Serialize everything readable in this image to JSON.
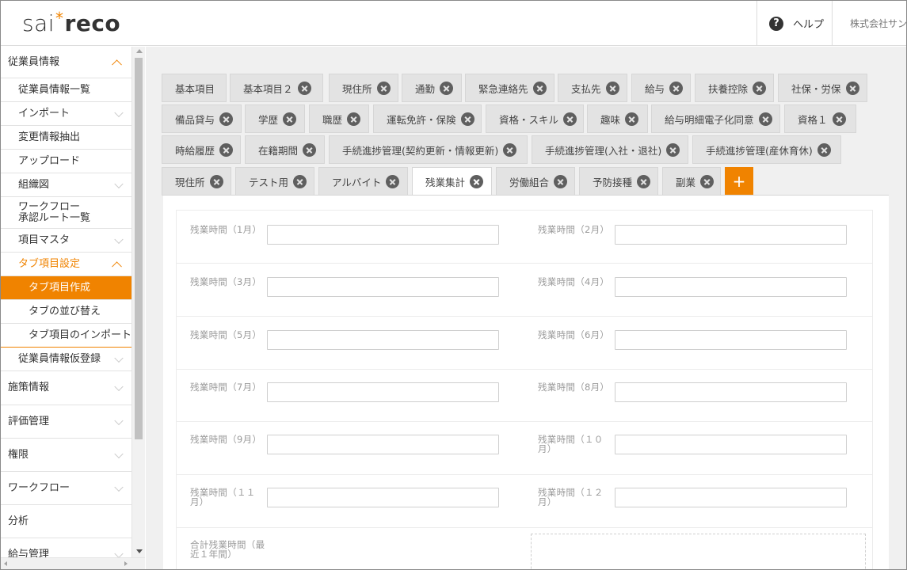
{
  "header": {
    "logo_part1": "sai",
    "logo_star": "*",
    "logo_part2": "reco",
    "help_icon": "?",
    "help_label": "ヘルプ",
    "company": "株式会社サン"
  },
  "sidebar": {
    "items": [
      {
        "label": "従業員情報"
      },
      {
        "label": "従業員情報一覧"
      },
      {
        "label": "インポート"
      },
      {
        "label": "変更情報抽出"
      },
      {
        "label": "アップロード"
      },
      {
        "label": "組織図"
      },
      {
        "label": "ワークフロー\n承認ルート一覧"
      },
      {
        "label": "項目マスタ"
      },
      {
        "label": "タブ項目設定"
      },
      {
        "label": "タブ項目作成"
      },
      {
        "label": "タブの並び替え"
      },
      {
        "label": "タブ項目のインポート"
      },
      {
        "label": "従業員情報仮登録"
      },
      {
        "label": "施策情報"
      },
      {
        "label": "評価管理"
      },
      {
        "label": "権限"
      },
      {
        "label": "ワークフロー"
      },
      {
        "label": "分析"
      },
      {
        "label": "給与管理"
      }
    ]
  },
  "tabs": [
    {
      "label": "基本項目"
    },
    {
      "label": "基本項目２"
    },
    {
      "label": "現住所"
    },
    {
      "label": "通勤"
    },
    {
      "label": "緊急連絡先"
    },
    {
      "label": "支払先"
    },
    {
      "label": "給与"
    },
    {
      "label": "扶養控除"
    },
    {
      "label": "社保・労保"
    },
    {
      "label": "備品貸与"
    },
    {
      "label": "学歴"
    },
    {
      "label": "職歴"
    },
    {
      "label": "運転免許・保険"
    },
    {
      "label": "資格・スキル"
    },
    {
      "label": "趣味"
    },
    {
      "label": "給与明細電子化同意"
    },
    {
      "label": "資格１"
    },
    {
      "label": "時給履歴"
    },
    {
      "label": "在籍期間"
    },
    {
      "label": "手続進捗管理(契約更新・情報更新)"
    },
    {
      "label": "手続進捗管理(入社・退社)"
    },
    {
      "label": "手続進捗管理(産休育休)"
    },
    {
      "label": "現住所"
    },
    {
      "label": "テスト用"
    },
    {
      "label": "アルバイト"
    },
    {
      "label": "残業集計"
    },
    {
      "label": "労働組合"
    },
    {
      "label": "予防接種"
    },
    {
      "label": "副業"
    }
  ],
  "add_tab_label": "+",
  "form": {
    "fields": [
      {
        "label": "残業時間（1月）",
        "value": ""
      },
      {
        "label": "残業時間（2月）",
        "value": ""
      },
      {
        "label": "残業時間（3月）",
        "value": ""
      },
      {
        "label": "残業時間（4月）",
        "value": ""
      },
      {
        "label": "残業時間（5月）",
        "value": ""
      },
      {
        "label": "残業時間（6月）",
        "value": ""
      },
      {
        "label": "残業時間（7月）",
        "value": ""
      },
      {
        "label": "残業時間（8月）",
        "value": ""
      },
      {
        "label": "残業時間（9月）",
        "value": ""
      },
      {
        "label": "残業時間（１０\n月）",
        "value": ""
      },
      {
        "label": "残業時間（１１\n月）",
        "value": ""
      },
      {
        "label": "残業時間（１２\n月）",
        "value": ""
      }
    ],
    "total_label": "合計残業時間（最\n近１年間）"
  }
}
